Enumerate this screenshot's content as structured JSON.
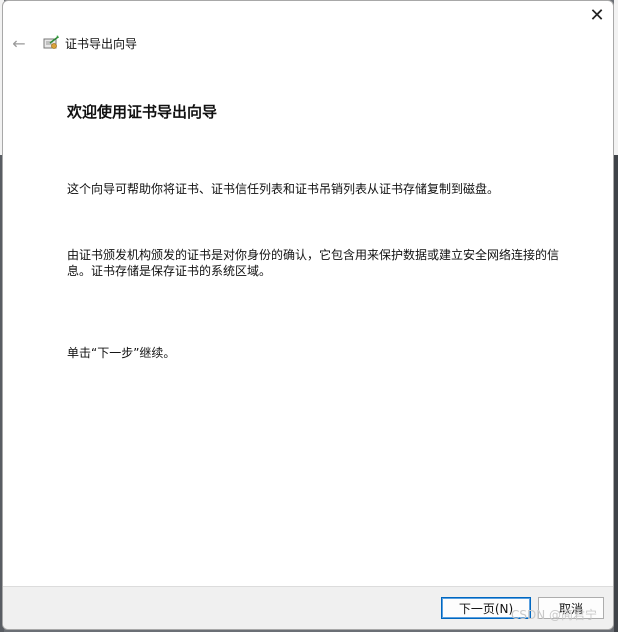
{
  "window": {
    "close_glyph": "✕",
    "back_glyph": "←",
    "title": "证书导出向导",
    "icon": "certificate-icon"
  },
  "content": {
    "heading": "欢迎使用证书导出向导",
    "para1": "这个向导可帮助你将证书、证书信任列表和证书吊销列表从证书存储复制到磁盘。",
    "para2_line1": "由证书颁发机构颁发的证书是对你身份的确认，它包含用来保护数据或建立安全网络连接的信",
    "para2_line2": "息。证书存储是保存证书的系统区域。",
    "para3": "单击“下一步”继续。"
  },
  "footer": {
    "next_label": "下一页(N)",
    "cancel_label": "取消"
  },
  "watermark": "CSDN @简君宁",
  "colors": {
    "accent": "#0067c0",
    "footer_bg": "#f0f0f0"
  }
}
